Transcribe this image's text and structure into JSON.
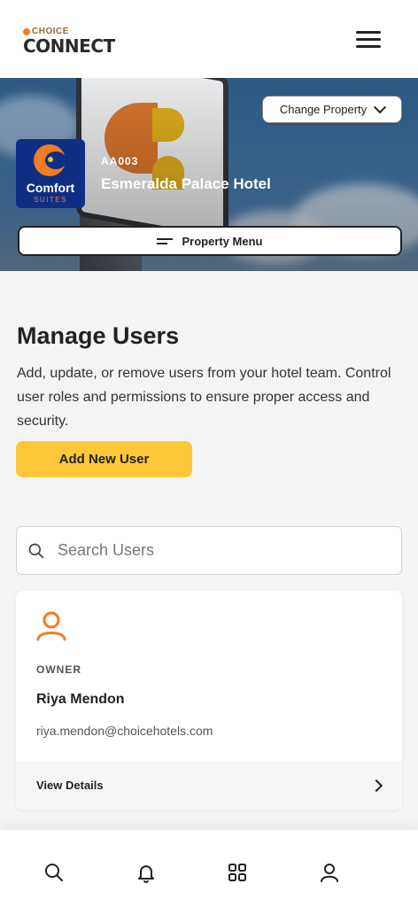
{
  "header": {
    "logo_small": "CHOICE",
    "logo_big": "CONNECT"
  },
  "hero": {
    "change_property_label": "Change Property",
    "brand_name": "Comfort",
    "brand_sub": "SUITES",
    "property_code": "AA003",
    "property_name": "Esmeralda Palace Hotel",
    "property_menu_label": "Property Menu"
  },
  "main": {
    "title": "Manage Users",
    "description": "Add, update, or remove users from your hotel team. Control user roles and permissions to ensure proper access and security.",
    "add_user_label": "Add New User"
  },
  "search": {
    "placeholder": "Search Users",
    "value": ""
  },
  "users": [
    {
      "role": "OWNER",
      "name": "Riya Mendon",
      "email": "riya.mendon@choicehotels.com",
      "view_details_label": "View Details"
    }
  ],
  "colors": {
    "accent": "#fec737",
    "brand_orange": "#f47b20",
    "brand_navy": "#0e2f84"
  },
  "icons": {
    "menu": "hamburger-icon",
    "search": "search-icon",
    "notifications": "bell-icon",
    "apps": "grid-icon",
    "profile": "user-icon"
  }
}
